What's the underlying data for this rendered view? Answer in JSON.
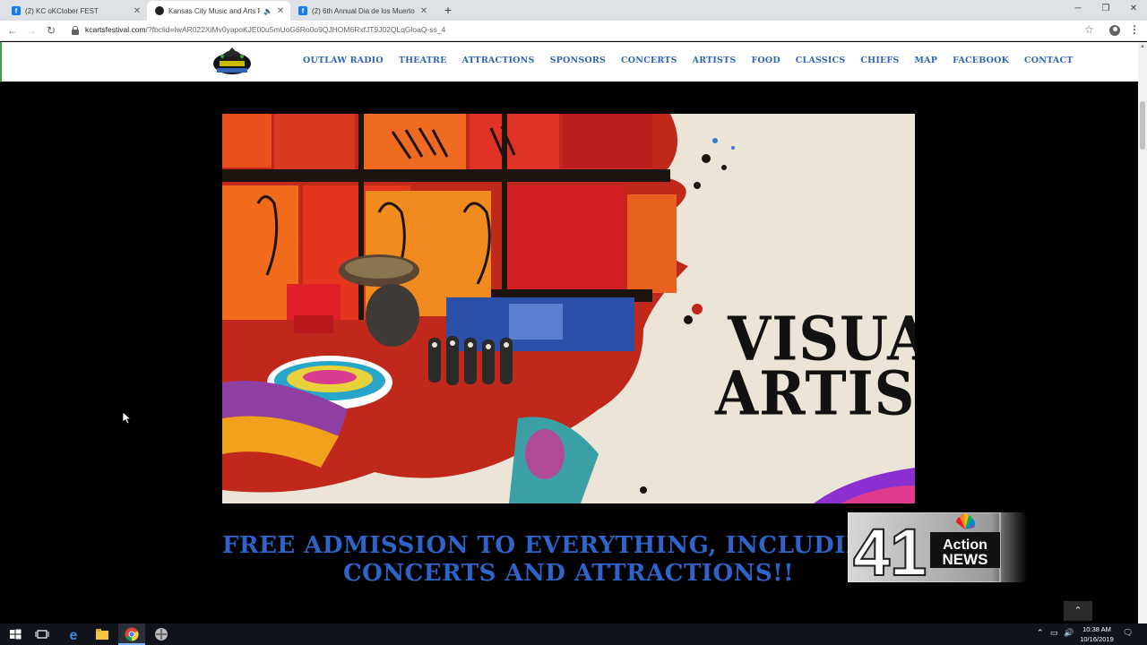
{
  "browser": {
    "tabs": [
      {
        "title": "(2) KC oKCtober FEST",
        "favicon": "facebook-icon",
        "active": false
      },
      {
        "title": "Kansas City Music and Arts Fe",
        "favicon": "kc-logo-icon",
        "active": true
      },
      {
        "title": "(2) 6th Annual Dia de los Muerto",
        "favicon": "facebook-icon",
        "active": false
      }
    ],
    "new_tab": "+",
    "window_controls": {
      "minimize": "─",
      "restore": "❐",
      "close": "✕"
    },
    "url_host": "kcartsfestival.com",
    "url_rest": "/?fbclid=IwAR022XiMv0yapoKJE00u5mUoG6Ro0o9QJHOM6RxfJT9J02QLqGloaQ-ss_4",
    "icons": {
      "back": "back-arrow-icon",
      "forward": "forward-arrow-icon",
      "reload": "reload-icon",
      "bookmark": "star-icon",
      "profile": "profile-icon",
      "menu": "kebab-icon"
    }
  },
  "site": {
    "nav": [
      "OUTLAW RADIO",
      "THEATRE",
      "ATTRACTIONS",
      "SPONSORS",
      "CONCERTS",
      "ARTISTS",
      "FOOD",
      "CLASSICS",
      "CHIEFS",
      "MAP",
      "FACEBOOK",
      "CONTACT"
    ],
    "hero": {
      "line1": "VISUAL",
      "line2": "ARTISTS"
    },
    "admission": {
      "line1": "FREE ADMISSION TO EVERYTHING, INCLUDING ALL",
      "line2": "CONCERTS AND ATTRACTIONS!!"
    },
    "to_top": "⌃"
  },
  "tv_bug": {
    "number": "41",
    "line1": "Action",
    "line2": "NEWS"
  },
  "taskbar": {
    "time": "10:38 AM",
    "date": "10/16/2019"
  },
  "colors": {
    "nav_blue": "#2f64b5",
    "admission_blue": "#2e63c9"
  }
}
